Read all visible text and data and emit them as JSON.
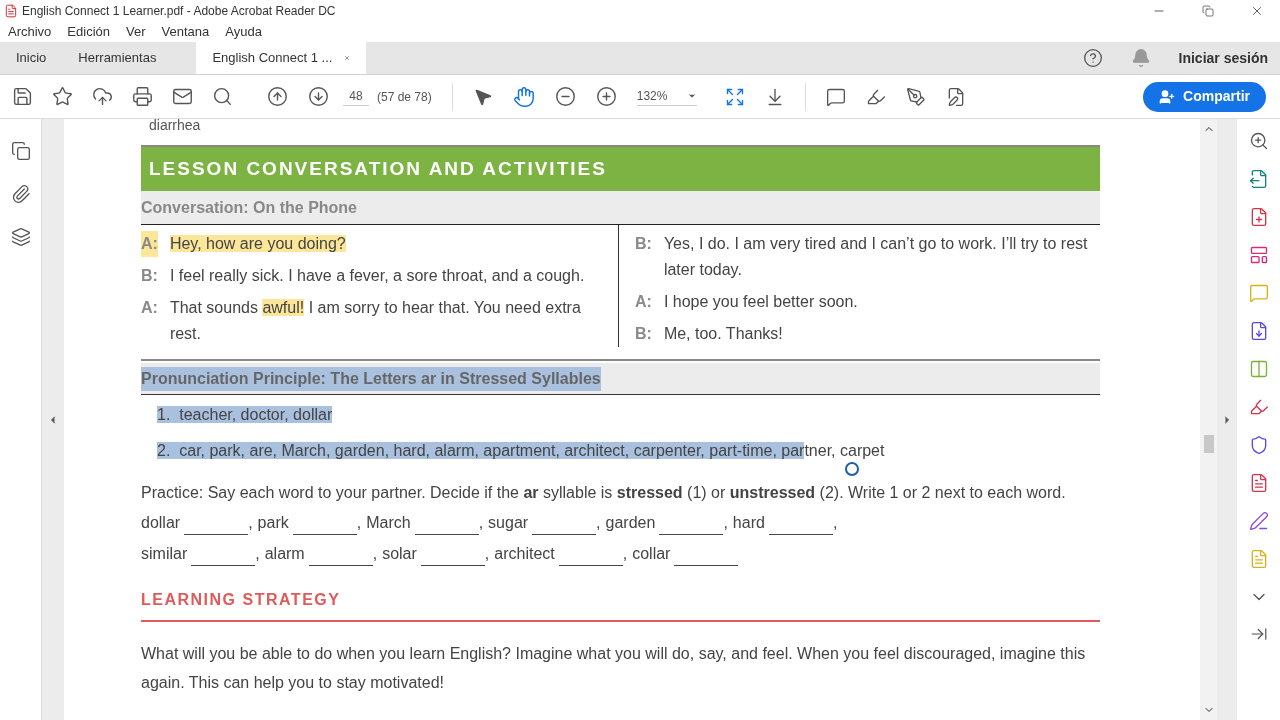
{
  "window": {
    "title": "English Connect 1 Learner.pdf - Adobe Acrobat Reader DC"
  },
  "menu": [
    "Archivo",
    "Edición",
    "Ver",
    "Ventana",
    "Ayuda"
  ],
  "tabs": [
    {
      "label": "Inicio",
      "selected": false
    },
    {
      "label": "Herramientas",
      "selected": false
    },
    {
      "label": "English Connect 1 ...",
      "selected": true
    }
  ],
  "account": {
    "sign_in": "Iniciar sesión"
  },
  "toolbar": {
    "page": "48",
    "page_count": "(57 de 78)",
    "zoom": "132%",
    "share": "Compartir"
  },
  "document": {
    "top_fragment": "diarrhea",
    "lesson_title": "LESSON CONVERSATION AND ACTIVITIES",
    "conversation": {
      "title": "Conversation: On the Phone",
      "columns": [
        [
          {
            "speaker": {
              "text": "A:",
              "highlighted": true,
              "selected": false
            },
            "segments": [
              {
                "text": "Hey, how are you doing?",
                "highlighted": true,
                "selected": false
              }
            ]
          },
          {
            "speaker": {
              "text": "B:",
              "highlighted": false,
              "selected": false
            },
            "segments": [
              {
                "text": "I feel really sick. I have a fever, a sore throat, and a cough.",
                "highlighted": false,
                "selected": false
              }
            ]
          },
          {
            "speaker": {
              "text": "A:",
              "highlighted": false,
              "selected": false
            },
            "segments": [
              {
                "text": "That sounds ",
                "highlighted": false,
                "selected": false
              },
              {
                "text": "awful!",
                "highlighted": true,
                "selected": false
              },
              {
                "text": " I am sorry to hear that. You need extra rest.",
                "highlighted": false,
                "selected": false
              }
            ]
          }
        ],
        [
          {
            "speaker": {
              "text": "B:",
              "highlighted": false,
              "selected": false
            },
            "segments": [
              {
                "text": "Yes, I do. I am very tired and I can’t go to work. I’ll try to rest later today.",
                "highlighted": false,
                "selected": false
              }
            ]
          },
          {
            "speaker": {
              "text": "A:",
              "highlighted": false,
              "selected": false
            },
            "segments": [
              {
                "text": "I hope you feel better soon.",
                "highlighted": false,
                "selected": false
              }
            ]
          },
          {
            "speaker": {
              "text": "B:",
              "highlighted": false,
              "selected": false
            },
            "segments": [
              {
                "text": "Me, too. Thanks!",
                "highlighted": false,
                "selected": false
              }
            ]
          }
        ]
      ]
    },
    "pronunciation": {
      "title": {
        "text": "Pronunciation Principle: The Letters ar in Stressed Syllables",
        "highlighted": false,
        "selected": true
      },
      "items": [
        {
          "number": {
            "text": "1.",
            "highlighted": false,
            "selected": true
          },
          "segments": [
            {
              "text": "teacher, doctor, dollar",
              "highlighted": false,
              "selected": true
            }
          ]
        },
        {
          "number": {
            "text": "2.",
            "highlighted": false,
            "selected": true
          },
          "segments": [
            {
              "text": "car, park, are, March, garden, hard, alarm, apartment, architect, carpenter, part-time, par",
              "highlighted": false,
              "selected": true
            },
            {
              "text": "tner, carpet",
              "highlighted": false,
              "selected": false
            }
          ]
        }
      ]
    },
    "practice": "Practice: Say each word to your partner. Decide if the **ar** syllable is **stressed** (1) or **unstressed** (2). Write 1 or 2 next to each word.",
    "word_rows": [
      [
        {
          "word": "dollar",
          "sep": ","
        },
        {
          "word": "park",
          "sep": ","
        },
        {
          "word": "March",
          "sep": ","
        },
        {
          "word": "sugar",
          "sep": ","
        },
        {
          "word": "garden",
          "sep": ","
        },
        {
          "word": "hard",
          "sep": ","
        }
      ],
      [
        {
          "word": "similar",
          "sep": ","
        },
        {
          "word": "alarm",
          "sep": ","
        },
        {
          "word": "solar",
          "sep": ","
        },
        {
          "word": "architect",
          "sep": ","
        },
        {
          "word": "collar"
        }
      ]
    ],
    "strategy": {
      "title": "LEARNING STRATEGY",
      "text": "What will you be able to do when you learn English? Imagine what you will do, say, and feel. When you feel discouraged, imagine this again. This can help you to stay motivated!"
    }
  }
}
